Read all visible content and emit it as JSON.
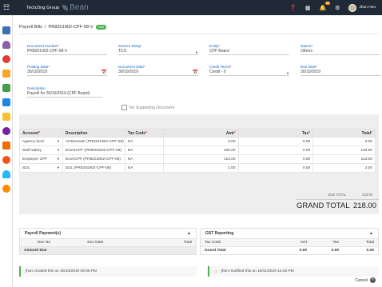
{
  "topbar": {
    "org": "TechZing Group",
    "brand": "Bean",
    "notification_count": "31",
    "user_name": "Jhon Heo"
  },
  "breadcrumb": {
    "root": "Payroll Bills",
    "separator": "/",
    "current": "PR8201902-CPF-08-V",
    "status": "Void"
  },
  "form": {
    "document_number": {
      "label": "Document Number",
      "value": "PR8201902-CPF-08-V"
    },
    "service_entity": {
      "label": "Service Entity",
      "value": "TCS"
    },
    "entity": {
      "label": "Entity",
      "value": "CPF Board"
    },
    "nature": {
      "label": "Nature",
      "value": "Others"
    },
    "posting_date": {
      "label": "Posting Date",
      "value": "30/10/2019"
    },
    "document_date": {
      "label": "Document Date",
      "value": "30/10/2019"
    },
    "credit_terms": {
      "label": "Credit Terms",
      "value": "Credit - 0"
    },
    "due_date": {
      "label": "Due Date",
      "value": "30/10/2019"
    },
    "description": {
      "label": "Description",
      "value": "Payroll for 30/10/2019 (CPF Board)"
    },
    "no_supporting_doc": "No Supporting Document"
  },
  "items_table": {
    "headers": [
      "Account",
      "Description",
      "Tax Code",
      "Amt",
      "Tax",
      "Total"
    ],
    "rows": [
      {
        "account": "Agency fund",
        "description": "AF&Donate (PR8201902-CPF-08)",
        "tax_code": "NA",
        "amt": "3.00",
        "tax": "0.00",
        "total": "3.00"
      },
      {
        "account": "Staff salary",
        "description": "EmeeCPF (PR8201902-CPF-08)",
        "tax_code": "NA",
        "amt": "100.00",
        "tax": "0.00",
        "total": "100.00"
      },
      {
        "account": "Employer CPF",
        "description": "EmerCPF (PR8201902-CPF-08)",
        "tax_code": "NA",
        "amt": "113.00",
        "tax": "0.00",
        "total": "113.00"
      },
      {
        "account": "SDL",
        "description": "SDL (PR8201902-CPF-08)",
        "tax_code": "NA",
        "amt": "2.00",
        "tax": "0.00",
        "total": "2.00"
      }
    ]
  },
  "totals": {
    "sub_total_label": "SUB TOTAL",
    "sub_total_value": "218.00",
    "grand_total_label": "GRAND TOTAL",
    "grand_total_value": "218.00"
  },
  "payroll_payments": {
    "title": "Payroll Payment(s)",
    "headers": [
      "Doc No",
      "Doc Date",
      "Total"
    ],
    "amount_due_label": "Amount Due"
  },
  "gst_reporting": {
    "title": "GST Reporting",
    "headers": [
      "Tax Code",
      "Amt",
      "Tax",
      "Total"
    ],
    "grand_total": {
      "label": "Grand Total",
      "amt": "0.00",
      "tax": "0.00",
      "total": "0.00"
    }
  },
  "log": {
    "created": "jhon created this on 30/10/2019 08:05 PM",
    "modified": "jhon modified this on 18/11/2019 12:40 PM"
  },
  "footer": {
    "cancel_label": "Cancel"
  },
  "colors": {
    "topbar": "#1f2a36",
    "label_blue": "#1565c0",
    "status_green": "#4caf50",
    "required_red": "#e53935"
  }
}
